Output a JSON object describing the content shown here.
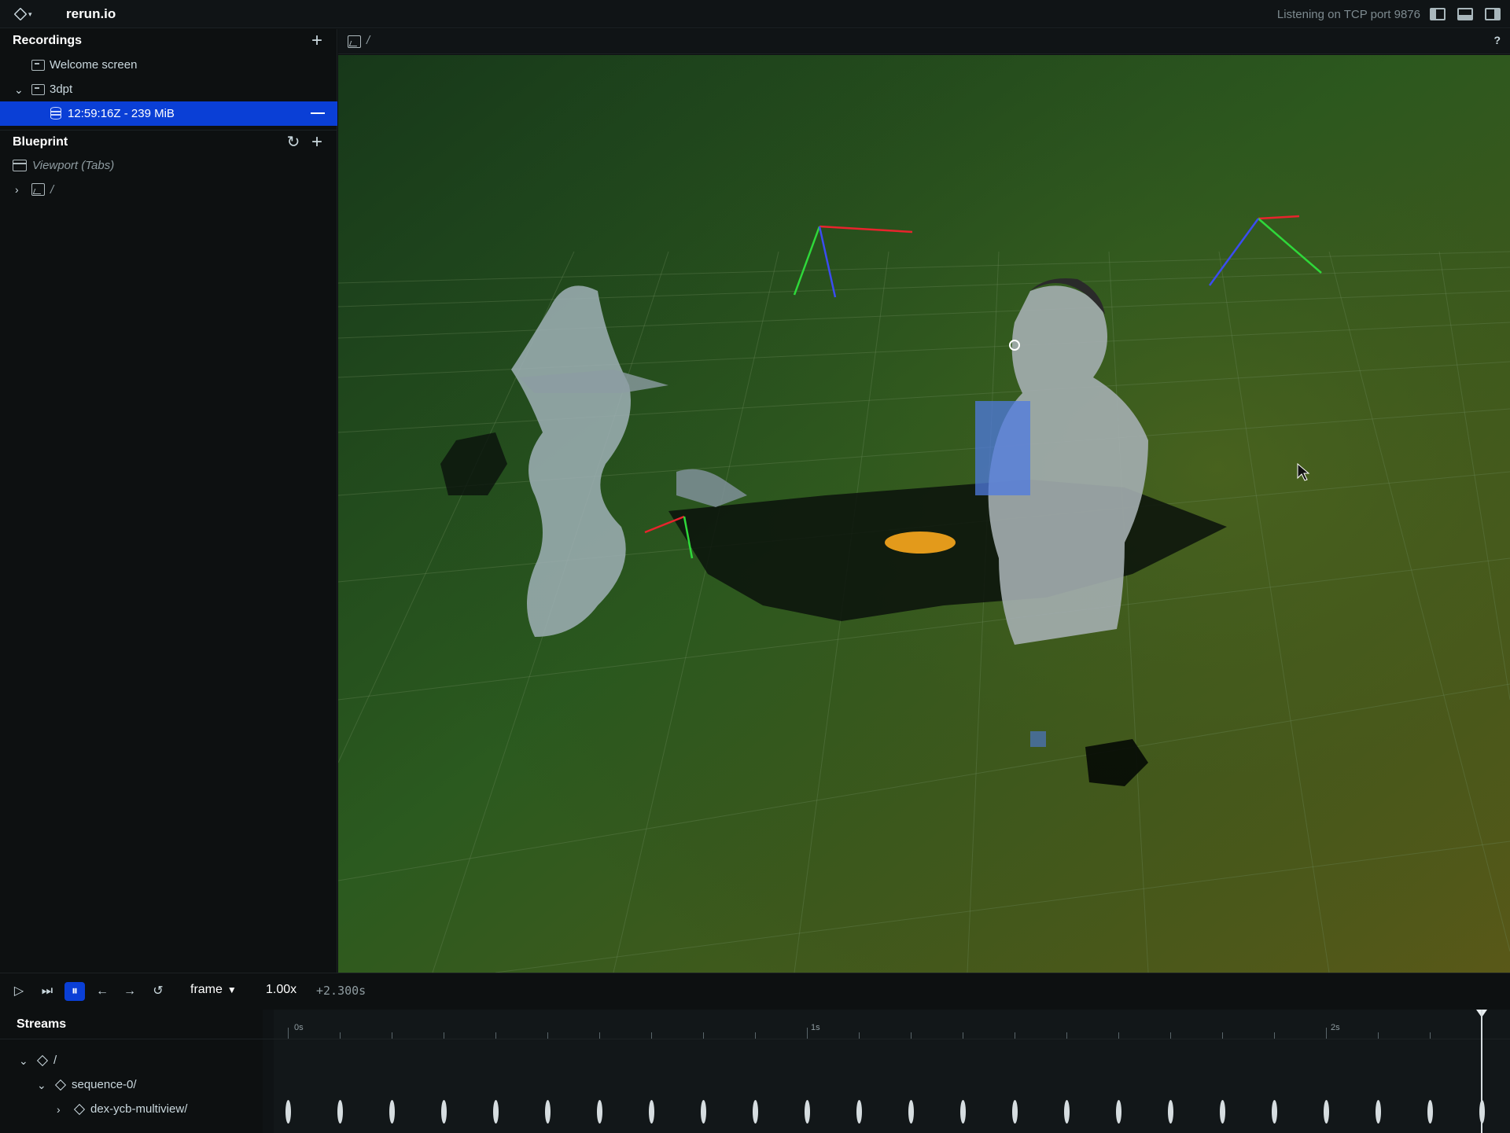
{
  "topbar": {
    "app_title": "rerun.io",
    "status": "Listening on TCP port 9876"
  },
  "recordings": {
    "title": "Recordings",
    "items": [
      {
        "label": "Welcome screen"
      },
      {
        "label": "3dpt"
      },
      {
        "label": "12:59:16Z - 239 MiB",
        "selected": true
      }
    ]
  },
  "blueprint": {
    "title": "Blueprint",
    "items": [
      {
        "label": "Viewport (Tabs)"
      },
      {
        "label": "/"
      }
    ]
  },
  "viewport": {
    "tab_label": "/",
    "help": "?"
  },
  "timepanel": {
    "timeline": "frame",
    "speed": "1.00x",
    "time": "+2.300s",
    "streams_title": "Streams",
    "tree": [
      {
        "label": "/"
      },
      {
        "label": "sequence-0/"
      },
      {
        "label": "dex-ycb-multiview/"
      }
    ],
    "ticks": [
      "0s",
      "1s",
      "2s"
    ]
  },
  "colors": {
    "accent": "#0a3fd6",
    "bg": "#0d1011",
    "scene_green": "#2a5e20"
  }
}
